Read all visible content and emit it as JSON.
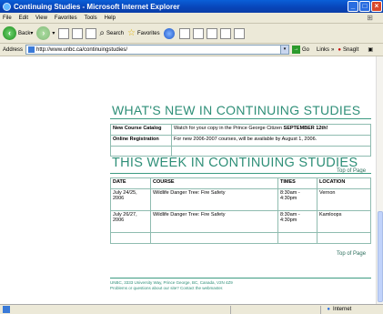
{
  "window": {
    "title": "Continuing Studies - Microsoft Internet Explorer"
  },
  "menu": [
    "File",
    "Edit",
    "View",
    "Favorites",
    "Tools",
    "Help"
  ],
  "toolbar": {
    "back": "Back",
    "search": "Search",
    "favorites": "Favorites"
  },
  "address": {
    "label": "Address",
    "url": "http://www.unbc.ca/continuingstudies/",
    "go": "Go",
    "links": "Links",
    "snagit": "SnagIt"
  },
  "whats_new": {
    "heading": "WHAT'S NEW IN CONTINUING STUDIES",
    "rows": [
      {
        "title": "New Course Catalog",
        "text": "Watch for your copy in the Prince George Citizen ",
        "bold": "SEPTEMBER 12th!"
      },
      {
        "title": "Online Registration",
        "text": "For new 2006-2007 courses, will be available by August 1, 2006."
      }
    ]
  },
  "top_of_page": "Top of Page",
  "this_week": {
    "heading": "THIS WEEK IN CONTINUING STUDIES",
    "headers": [
      "DATE",
      "COURSE",
      "TIMES",
      "LOCATION"
    ],
    "rows": [
      {
        "date": "July 24/25, 2006",
        "course": "Wildlife Danger Tree: Fire Safety",
        "times": "8:30am - 4:30pm",
        "location": "Vernon"
      },
      {
        "date": "July 26/27, 2006",
        "course": "Wildlife Danger Tree: Fire Safety",
        "times": "8:30am - 4:30pm",
        "location": "Kamloops"
      }
    ]
  },
  "footer": {
    "line1": "UNBC, 3333 University Way, Prince George, BC, Canada, V2N 4Z9",
    "line2": "Problems or questions about our site? Contact the webmaster."
  },
  "status": {
    "zone": "Internet"
  }
}
